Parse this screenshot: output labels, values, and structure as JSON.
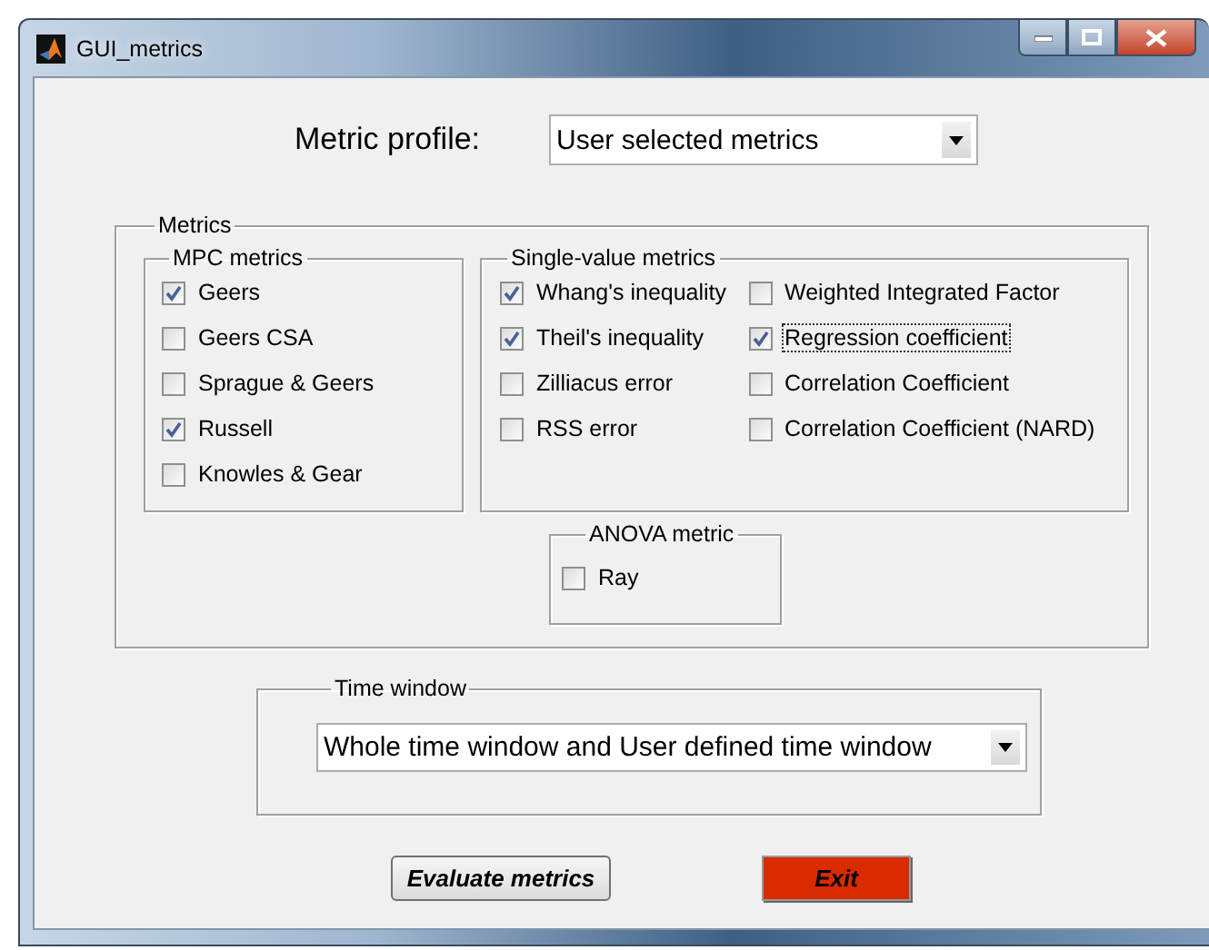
{
  "window": {
    "title": "GUI_metrics"
  },
  "metric_profile": {
    "label": "Metric profile:",
    "value": "User selected metrics"
  },
  "metrics": {
    "title": "Metrics",
    "mpc": {
      "title": "MPC metrics",
      "items": [
        {
          "label": "Geers",
          "checked": true,
          "focused": false
        },
        {
          "label": "Geers CSA",
          "checked": false,
          "focused": false
        },
        {
          "label": "Sprague & Geers",
          "checked": false,
          "focused": false
        },
        {
          "label": "Russell",
          "checked": true,
          "focused": false
        },
        {
          "label": "Knowles & Gear",
          "checked": false,
          "focused": false
        }
      ]
    },
    "single_value": {
      "title": "Single-value metrics",
      "items": [
        {
          "label": "Whang's inequality",
          "checked": true,
          "focused": false
        },
        {
          "label": "Theil's inequality",
          "checked": true,
          "focused": false
        },
        {
          "label": "Zilliacus error",
          "checked": false,
          "focused": false
        },
        {
          "label": "RSS error",
          "checked": false,
          "focused": false
        },
        {
          "label": "Weighted Integrated Factor",
          "checked": false,
          "focused": false
        },
        {
          "label": "Regression coefficient",
          "checked": true,
          "focused": true
        },
        {
          "label": "Correlation Coefficient",
          "checked": false,
          "focused": false
        },
        {
          "label": "Correlation Coefficient (NARD)",
          "checked": false,
          "focused": false
        }
      ]
    },
    "anova": {
      "title": "ANOVA metric",
      "items": [
        {
          "label": "Ray",
          "checked": false,
          "focused": false
        }
      ]
    }
  },
  "time_window": {
    "title": "Time window",
    "value": "Whole time window and User defined time window"
  },
  "buttons": [
    {
      "label": "Evaluate metrics",
      "kind": "default"
    },
    {
      "label": "Exit",
      "kind": "danger"
    }
  ]
}
